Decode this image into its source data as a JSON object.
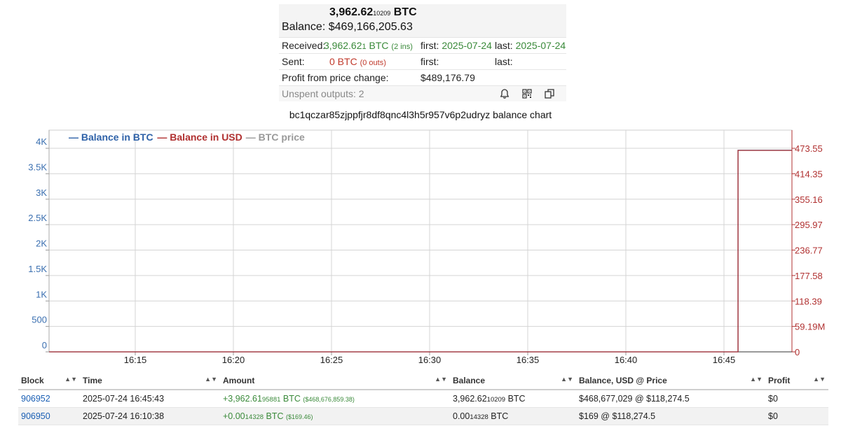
{
  "summary": {
    "btc_main": "3,962.62",
    "btc_small": "10209",
    "btc_unit": "BTC",
    "balance_label": "Balance:",
    "balance_usd": "$469,166,205.63",
    "received_label": "Received:",
    "received_main": "3,962.62",
    "received_small": "1",
    "received_unit": " BTC",
    "received_ins": "(2 ins)",
    "first_label": "first:",
    "received_first": "2025-07-24",
    "last_label": "last:",
    "received_last": "2025-07-24",
    "sent_label": "Sent:",
    "sent_value": "0 BTC",
    "sent_outs": "(0 outs)",
    "sent_first": "",
    "sent_last": "",
    "profit_label": "Profit from price change:",
    "profit_value": "$489,176.79",
    "unspent_label": "Unspent outputs: 2",
    "icons": [
      "bell-icon",
      "qr-code-icon",
      "copy-icon"
    ]
  },
  "chart_title": "bc1qczar85zjppfjr8df8qnc4l3h5r957v6p2udryz balance chart",
  "chart_data": {
    "type": "line",
    "legend": [
      "Balance in BTC",
      "Balance in USD",
      "BTC price"
    ],
    "legend_placement": "top-left",
    "x_ticks": [
      "16:15",
      "16:20",
      "16:25",
      "16:30",
      "16:35",
      "16:40",
      "16:45"
    ],
    "y_left_ticks": [
      "0",
      "500",
      "1K",
      "1.5K",
      "2K",
      "2.5K",
      "3K",
      "3.5K",
      "4K"
    ],
    "y_right_ticks": [
      "0",
      "59.19M",
      "118.39",
      "177.58",
      "236.77",
      "295.97",
      "355.16",
      "414.35",
      "473.55"
    ],
    "y_left_range": [
      0,
      4000
    ],
    "y_right_range": [
      0,
      473550000
    ],
    "series": [
      {
        "name": "Balance in BTC",
        "color": "#2f62a8",
        "points": [
          [
            "16:10:38",
            0.00014328
          ],
          [
            "16:45:43",
            3962.62
          ]
        ]
      },
      {
        "name": "Balance in USD",
        "color": "#b03030",
        "points": [
          [
            "16:10:38",
            169
          ],
          [
            "16:45:43",
            468677029
          ]
        ]
      }
    ],
    "grid": true
  },
  "table": {
    "headers": [
      "Block",
      "Time",
      "Amount",
      "Balance",
      "Balance, USD @ Price",
      "Profit"
    ],
    "rows": [
      {
        "block": "906952",
        "time": "2025-07-24 16:45:43",
        "amount_main": "+3,962.61",
        "amount_small": "95881",
        "amount_unit": " BTC",
        "amount_usd": "($468,676,859.38)",
        "balance_main": "3,962.62",
        "balance_small": "10209",
        "balance_unit": " BTC",
        "balance_usd": "$468,677,029 @ $118,274.5",
        "profit": "$0"
      },
      {
        "block": "906950",
        "time": "2025-07-24 16:10:38",
        "amount_main": "+0.00",
        "amount_small": "14328",
        "amount_unit": " BTC",
        "amount_usd": "($169.46)",
        "balance_main": "0.00",
        "balance_small": "14328",
        "balance_unit": " BTC",
        "balance_usd": "$169 @ $118,274.5",
        "profit": "$0"
      }
    ]
  }
}
